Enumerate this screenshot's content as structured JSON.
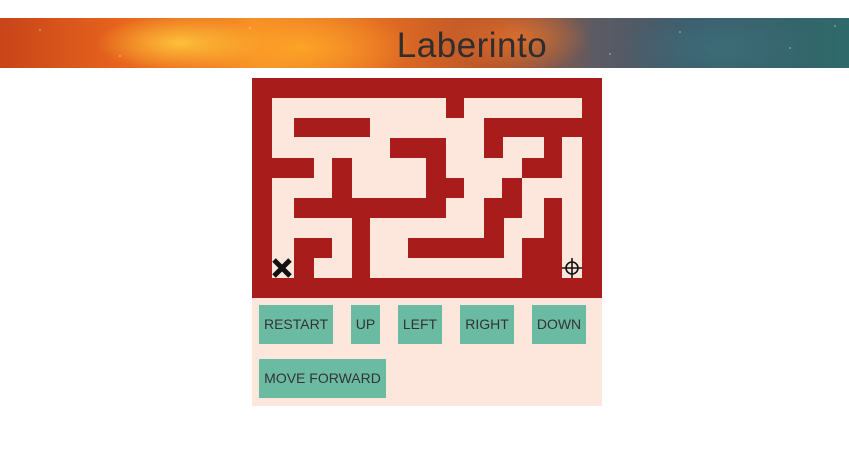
{
  "header": {
    "title": "Laberinto"
  },
  "maze": {
    "colors": {
      "wall": "#a81c1c",
      "path": "#fde6dc",
      "marker": "#111111"
    },
    "player_icon": "x-mark-icon",
    "goal_icon": "crosshair-target-icon"
  },
  "controls": {
    "restart_label": "RESTART",
    "up_label": "UP",
    "left_label": "LEFT",
    "right_label": "RIGHT",
    "down_label": "DOWN",
    "move_forward_label": "MOVE FORWARD"
  }
}
